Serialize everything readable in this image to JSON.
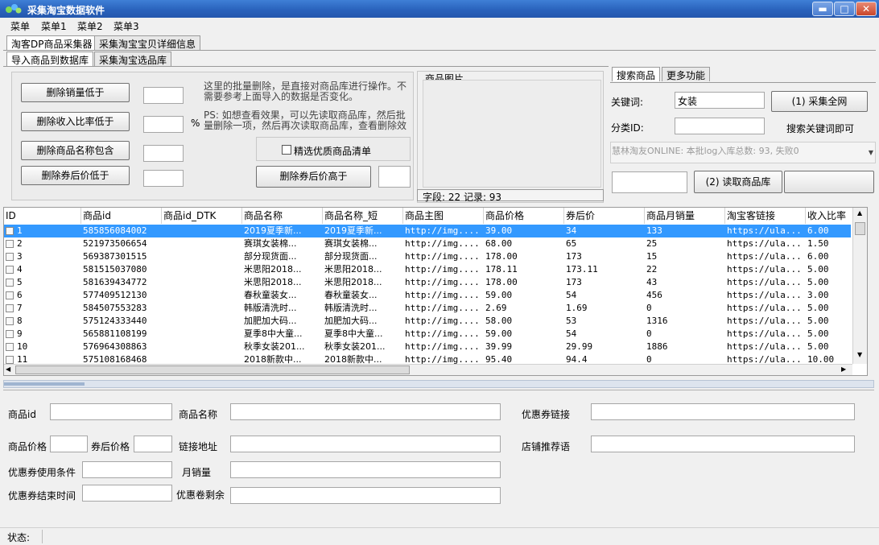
{
  "window": {
    "title": "采集淘宝数据软件",
    "btn_min": "▬",
    "btn_max": "□",
    "btn_close": "✕"
  },
  "menu": [
    "菜单",
    "菜单1",
    "菜单2",
    "菜单3"
  ],
  "tabs_top": [
    "淘客DP商品采集器",
    "采集淘宝宝贝详细信息"
  ],
  "tabs_sub": [
    "导入商品到数据库",
    "采集淘宝选品库"
  ],
  "left_panel": {
    "btn_del_sales": "删除销量低于",
    "btn_del_income": "删除收入比率低于",
    "percent": "%",
    "btn_del_name": "删除商品名称包含",
    "btn_del_after": "删除券后价低于",
    "note1": "这里的批量删除，是直接对商品库进行操作。不需要参考上面导入的数据是否变化。",
    "note2": "PS: 如想查看效果，可以先读取商品库，然后批量删除一项，然后再次读取商品库，查看删除效",
    "chk_quality": "精选优质商品清单",
    "btn_del_after_high": "删除券后价高于"
  },
  "picture": {
    "legend": "商品图片",
    "status": "字段: 22 记录: 93"
  },
  "search": {
    "tabs": [
      "搜索商品",
      "更多功能"
    ],
    "kw_label": "关键词:",
    "kw_value": "女装",
    "btn_collect": "(1) 采集全网",
    "cat_label": "分类ID:",
    "cat_value": "",
    "hint": "搜索关键词即可",
    "log": "慧林淘友ONLINE: 本批log入库总数: 93, 失败0",
    "btn_read": "(2) 读取商品库"
  },
  "grid": {
    "columns": [
      "ID",
      "商品id",
      "商品id_DTK",
      "商品名称",
      "商品名称_短",
      "商品主图",
      "商品价格",
      "券后价",
      "商品月销量",
      "淘宝客链接",
      "收入比率"
    ],
    "rows": [
      [
        "1",
        "585856084002",
        "",
        "2019夏季新...",
        "2019夏季新...",
        "http://img....",
        "39.00",
        "34",
        "133",
        "https://ula...",
        "6.00"
      ],
      [
        "2",
        "521973506654",
        "",
        "赛琪女装棉...",
        "赛琪女装棉...",
        "http://img....",
        "68.00",
        "65",
        "25",
        "https://ula...",
        "1.50"
      ],
      [
        "3",
        "569387301515",
        "",
        "部分现货面...",
        "部分现货面...",
        "http://img....",
        "178.00",
        "173",
        "15",
        "https://ula...",
        "6.00"
      ],
      [
        "4",
        "581515037080",
        "",
        "米思阳2018...",
        "米思阳2018...",
        "http://img....",
        "178.11",
        "173.11",
        "22",
        "https://ula...",
        "5.00"
      ],
      [
        "5",
        "581639434772",
        "",
        "米思阳2018...",
        "米思阳2018...",
        "http://img....",
        "178.00",
        "173",
        "43",
        "https://ula...",
        "5.00"
      ],
      [
        "6",
        "577409512130",
        "",
        "春秋童装女...",
        "春秋童装女...",
        "http://img....",
        "59.00",
        "54",
        "456",
        "https://ula...",
        "3.00"
      ],
      [
        "7",
        "584507553283",
        "",
        "韩版清洗时...",
        "韩版清洗时...",
        "http://img....",
        "2.69",
        "1.69",
        "0",
        "https://ula...",
        "5.00"
      ],
      [
        "8",
        "575124333440",
        "",
        "加肥加大码...",
        "加肥加大码...",
        "http://img....",
        "58.00",
        "53",
        "1316",
        "https://ula...",
        "5.00"
      ],
      [
        "9",
        "565881108199",
        "",
        "夏季8中大童...",
        "夏季8中大童...",
        "http://img....",
        "59.00",
        "54",
        "0",
        "https://ula...",
        "5.00"
      ],
      [
        "10",
        "576964308863",
        "",
        "秋季女装201...",
        "秋季女装201...",
        "http://img....",
        "39.99",
        "29.99",
        "1886",
        "https://ula...",
        "5.00"
      ],
      [
        "11",
        "575108168468",
        "",
        "2018新款中...",
        "2018新款中...",
        "http://img....",
        "95.40",
        "94.4",
        "0",
        "https://ula...",
        "10.00"
      ]
    ]
  },
  "detail": {
    "item_id": "商品id",
    "item_name": "商品名称",
    "coupon_link": "优惠券链接",
    "price": "商品价格",
    "after_price": "券后价格",
    "link": "链接地址",
    "shop_slogan": "店铺推荐语",
    "coupon_cond": "优惠券使用条件",
    "monthly_sales": "月销量",
    "coupon_end": "优惠券结束时间",
    "coupon_left": "优惠卷剩余"
  },
  "status": {
    "label": "状态:"
  }
}
